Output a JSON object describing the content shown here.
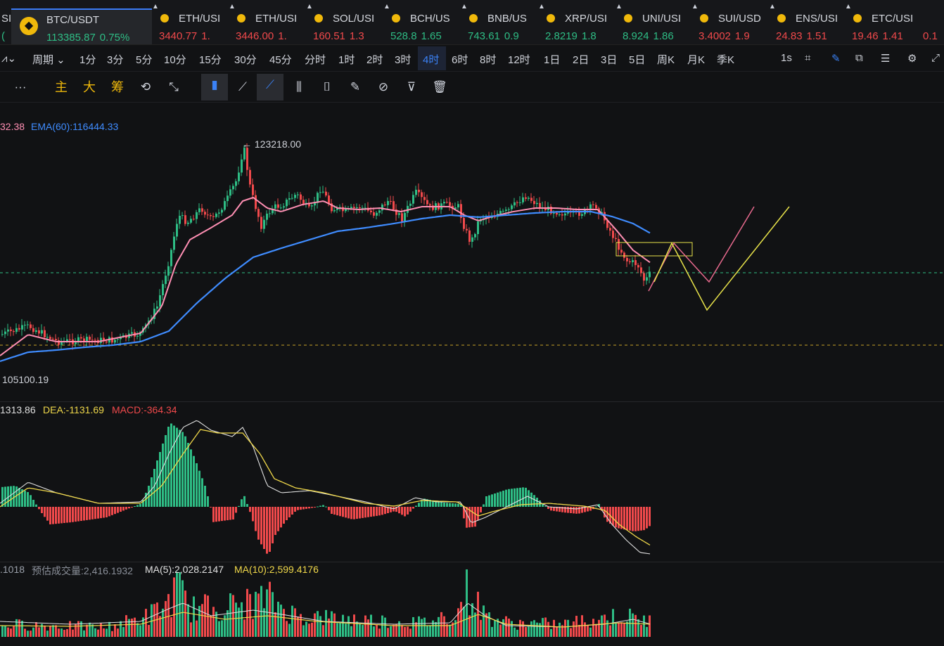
{
  "ticker": [
    {
      "symbol": "SI",
      "price": "(",
      "change": "",
      "trend": "up",
      "partial": true
    },
    {
      "symbol": "BTC/USDT",
      "price": "113385.87",
      "change": "0.75%",
      "trend": "up",
      "active": true
    },
    {
      "symbol": "ETH/USI",
      "price": "3440.77",
      "change": "1.",
      "trend": "down"
    },
    {
      "symbol": "ETH/USI",
      "price": "3446.00",
      "change": "1.",
      "trend": "down"
    },
    {
      "symbol": "SOL/USI",
      "price": "160.51",
      "change": "1.3",
      "trend": "down"
    },
    {
      "symbol": "BCH/US",
      "price": "528.8",
      "change": "1.65",
      "trend": "up"
    },
    {
      "symbol": "BNB/US",
      "price": "743.61",
      "change": "0.9",
      "trend": "up"
    },
    {
      "symbol": "XRP/USI",
      "price": "2.8219",
      "change": "1.8",
      "trend": "up"
    },
    {
      "symbol": "UNI/USI",
      "price": "8.924",
      "change": "1.86",
      "trend": "up"
    },
    {
      "symbol": "SUI/USD",
      "price": "3.4002",
      "change": "1.9",
      "trend": "down"
    },
    {
      "symbol": "ENS/USI",
      "price": "24.83",
      "change": "1.51",
      "trend": "down"
    },
    {
      "symbol": "ETC/USI",
      "price": "19.46",
      "change": "1.41",
      "trend": "down"
    },
    {
      "symbol": "",
      "price": "0.1",
      "change": "",
      "trend": "down",
      "partial": true
    }
  ],
  "intervals": {
    "indicator_icon": "wave-icon",
    "period_label": "周期",
    "items": [
      "1分",
      "3分",
      "5分",
      "10分",
      "15分",
      "30分",
      "45分",
      "分时",
      "1时",
      "2时",
      "3时",
      "4时",
      "6时",
      "8时",
      "12时",
      "1日",
      "2日",
      "3日",
      "5日",
      "周K",
      "月K",
      "季K"
    ],
    "active": "4时",
    "right_label": "1s",
    "right_icons": [
      "camera-icon",
      "pencil-icon",
      "popout-icon",
      "list-icon",
      "settings-icon",
      "fullscreen-icon"
    ]
  },
  "tools": {
    "more": "···",
    "cn_buttons": [
      "主",
      "大",
      "筹"
    ],
    "icons": [
      "replay-icon",
      "indicator-edit-icon",
      "bookmark-icon",
      "ruler-icon",
      "trendline-icon",
      "candles-icon",
      "bracket-icon",
      "note-icon",
      "magnet-icon",
      "filter-icon",
      "trash-icon"
    ]
  },
  "main_pane": {
    "legend_partial": "32.38",
    "ema60_label": "EMA(60):116444.33",
    "high_label": "← 123218.00",
    "low_label": "105100.19",
    "colors": {
      "up": "#2ebd85",
      "down": "#f0494b",
      "ema_fast": "#ff8fb3",
      "ema60": "#3f8cff",
      "box": "#e8e34a",
      "dashed_green": "#2ebd85",
      "dashed_yellow": "#c9a227"
    }
  },
  "macd_pane": {
    "dif_partial": "1313.86",
    "dea_label": "DEA:-1131.69",
    "macd_label": "MACD:-364.34",
    "colors": {
      "dea": "#f0d84a",
      "macd": "#f0494b",
      "dif": "#e0e0e0"
    }
  },
  "volume_pane": {
    "vol_partial": ".1018",
    "est_label": "预估成交量:2,416.1932",
    "ma5_label": "MA(5):2,028.2147",
    "ma10_label": "MA(10):2,599.4176",
    "colors": {
      "ma5": "#e0e0e0",
      "ma10": "#f0d84a"
    }
  }
}
